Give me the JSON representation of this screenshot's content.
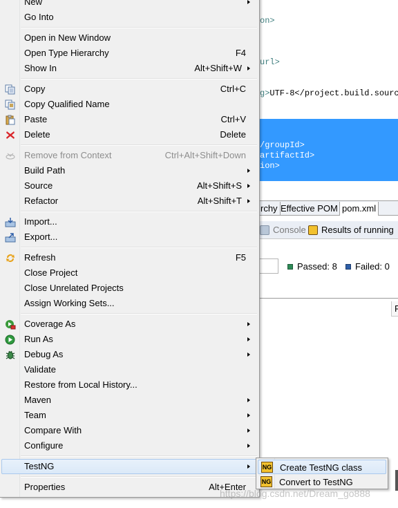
{
  "editor": {
    "lines": [
      {
        "pre": "",
        "tag": "on>",
        "post": ""
      },
      {
        "pre": "",
        "tag": "url>",
        "post": ""
      },
      {
        "pre": "",
        "tag": "g>",
        "post": "UTF-8</project.build.source"
      }
    ],
    "selected_lines": [
      "/groupId>",
      "artifactId>",
      "ion>"
    ]
  },
  "editor_tabs": [
    "rchy",
    "Effective POM",
    "pom.xml"
  ],
  "views": {
    "console_label": "Console",
    "results_label": "Results of running"
  },
  "stats": {
    "passed": "Passed: 8",
    "failed": "Failed: 0"
  },
  "column_header": "F",
  "menu": {
    "items": [
      {
        "label": "New",
        "shortcut": "",
        "submenu": true
      },
      {
        "label": "Go Into",
        "shortcut": ""
      },
      {
        "label": "Open in New Window",
        "shortcut": ""
      },
      {
        "label": "Open Type Hierarchy",
        "shortcut": "F4"
      },
      {
        "label": "Show In",
        "shortcut": "Alt+Shift+W",
        "submenu": true
      },
      {
        "label": "Copy",
        "shortcut": "Ctrl+C",
        "icon": "copy-icon"
      },
      {
        "label": "Copy Qualified Name",
        "shortcut": "",
        "icon": "copy-qualified-icon"
      },
      {
        "label": "Paste",
        "shortcut": "Ctrl+V",
        "icon": "paste-icon"
      },
      {
        "label": "Delete",
        "shortcut": "Delete",
        "icon": "delete-icon"
      },
      {
        "label": "Remove from Context",
        "shortcut": "Ctrl+Alt+Shift+Down",
        "disabled": true,
        "icon": "remove-context-icon"
      },
      {
        "label": "Build Path",
        "shortcut": "",
        "submenu": true
      },
      {
        "label": "Source",
        "shortcut": "Alt+Shift+S",
        "submenu": true
      },
      {
        "label": "Refactor",
        "shortcut": "Alt+Shift+T",
        "submenu": true
      },
      {
        "label": "Import...",
        "shortcut": "",
        "icon": "import-icon"
      },
      {
        "label": "Export...",
        "shortcut": "",
        "icon": "export-icon"
      },
      {
        "label": "Refresh",
        "shortcut": "F5",
        "icon": "refresh-icon"
      },
      {
        "label": "Close Project",
        "shortcut": ""
      },
      {
        "label": "Close Unrelated Projects",
        "shortcut": ""
      },
      {
        "label": "Assign Working Sets...",
        "shortcut": ""
      },
      {
        "label": "Coverage As",
        "shortcut": "",
        "submenu": true,
        "icon": "coverage-icon"
      },
      {
        "label": "Run As",
        "shortcut": "",
        "submenu": true,
        "icon": "run-icon"
      },
      {
        "label": "Debug As",
        "shortcut": "",
        "submenu": true,
        "icon": "debug-icon"
      },
      {
        "label": "Validate",
        "shortcut": ""
      },
      {
        "label": "Restore from Local History...",
        "shortcut": ""
      },
      {
        "label": "Maven",
        "shortcut": "",
        "submenu": true
      },
      {
        "label": "Team",
        "shortcut": "",
        "submenu": true
      },
      {
        "label": "Compare With",
        "shortcut": "",
        "submenu": true
      },
      {
        "label": "Configure",
        "shortcut": "",
        "submenu": true
      },
      {
        "label": "TestNG",
        "shortcut": "",
        "submenu": true,
        "highlighted": true
      },
      {
        "label": "Properties",
        "shortcut": "Alt+Enter"
      }
    ]
  },
  "testng_submenu": {
    "items": [
      {
        "label": "Create TestNG class",
        "icon": "testng-icon",
        "highlighted": true
      },
      {
        "label": "Convert to TestNG",
        "icon": "testng-icon"
      }
    ],
    "icon_text": "NG"
  },
  "watermark": "https://blog.csdn.net/Dream_go888",
  "colors": {
    "selection_blue": "#3399ff",
    "menu_bg": "#f0f0f0",
    "passed_green": "#2e8b57",
    "failed_blue": "#2f5fa8",
    "testng_yellow": "#f2c12e"
  }
}
